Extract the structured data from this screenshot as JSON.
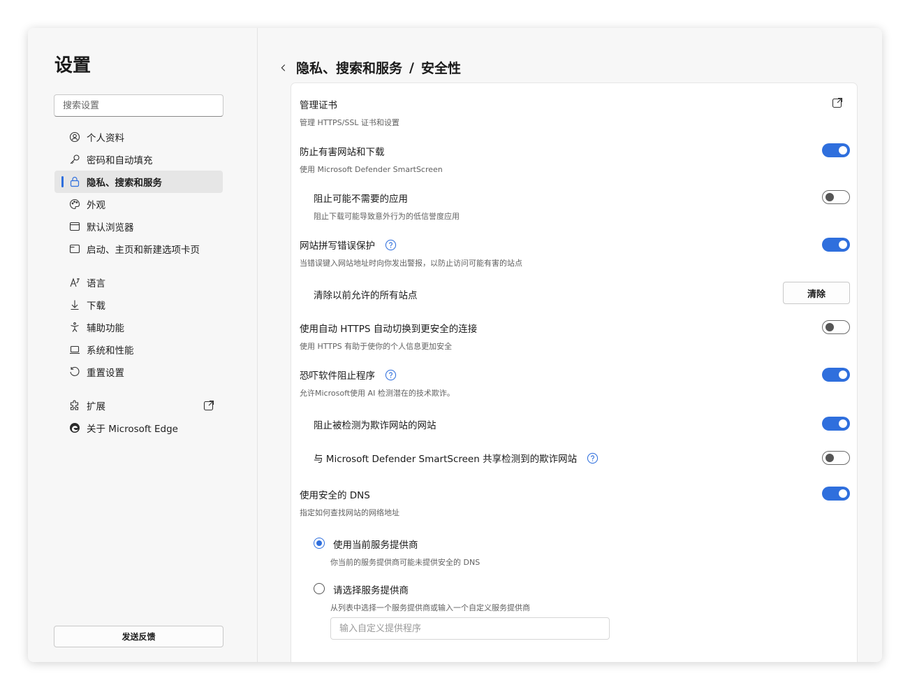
{
  "sidebar": {
    "title": "设置",
    "search_placeholder": "搜索设置",
    "items": [
      {
        "label": "个人资料",
        "icon": "profile-icon"
      },
      {
        "label": "密码和自动填充",
        "icon": "key-icon"
      },
      {
        "label": "隐私、搜索和服务",
        "icon": "lock-icon",
        "active": true
      },
      {
        "label": "外观",
        "icon": "palette-icon"
      },
      {
        "label": "默认浏览器",
        "icon": "browser-icon"
      },
      {
        "label": "启动、主页和新建选项卡页",
        "icon": "window-icon"
      },
      {
        "label": "语言",
        "icon": "language-icon"
      },
      {
        "label": "下载",
        "icon": "download-icon"
      },
      {
        "label": "辅助功能",
        "icon": "accessibility-icon"
      },
      {
        "label": "系统和性能",
        "icon": "laptop-icon"
      },
      {
        "label": "重置设置",
        "icon": "reset-icon"
      },
      {
        "label": "扩展",
        "icon": "puzzle-icon"
      },
      {
        "label": "关于 Microsoft Edge",
        "icon": "edge-logo-icon"
      }
    ],
    "feedback_label": "发送反馈"
  },
  "header": {
    "parent": "隐私、搜索和服务",
    "separator": "/",
    "current": "安全性"
  },
  "settings": {
    "cert_title": "管理证书",
    "cert_desc": "管理 HTTPS/SSL 证书和设置",
    "smartscreen_title": "防止有害网站和下载",
    "smartscreen_desc": "使用 Microsoft Defender SmartScreen",
    "pua_title": "阻止可能不需要的应用",
    "pua_desc": "阻止下载可能导致意外行为的低信誉度应用",
    "typo_title": "网站拼写错误保护",
    "typo_desc": "当错误键入网站地址时向你发出警报，以防止访问可能有害的站点",
    "clear_title": "清除以前允许的所有站点",
    "clear_button": "清除",
    "https_title": "使用自动 HTTPS 自动切换到更安全的连接",
    "https_desc": "使用 HTTPS 有助于使你的个人信息更加安全",
    "scareware_title": "恐吓软件阻止程序",
    "scareware_desc": "允许Microsoft使用 AI 检测潜在的技术欺诈。",
    "block_scam_title": "阻止被检测为欺诈网站的网站",
    "share_title": "与 Microsoft Defender SmartScreen 共享检测到的欺诈网站",
    "dns_title": "使用安全的 DNS",
    "dns_desc": "指定如何查找网站的网络地址",
    "dns_current_title": "使用当前服务提供商",
    "dns_current_desc": "你当前的服务提供商可能未提供安全的 DNS",
    "dns_choose_title": "请选择服务提供商",
    "dns_choose_desc": "从列表中选择一个服务提供商或输入一个自定义服务提供商",
    "dns_custom_placeholder": "输入自定义提供程序"
  },
  "toggles": {
    "smartscreen": true,
    "pua": false,
    "typo": true,
    "https": false,
    "scareware": true,
    "block_scam": true,
    "share": false,
    "dns": true
  },
  "colors": {
    "accent": "#2f6fdd"
  }
}
